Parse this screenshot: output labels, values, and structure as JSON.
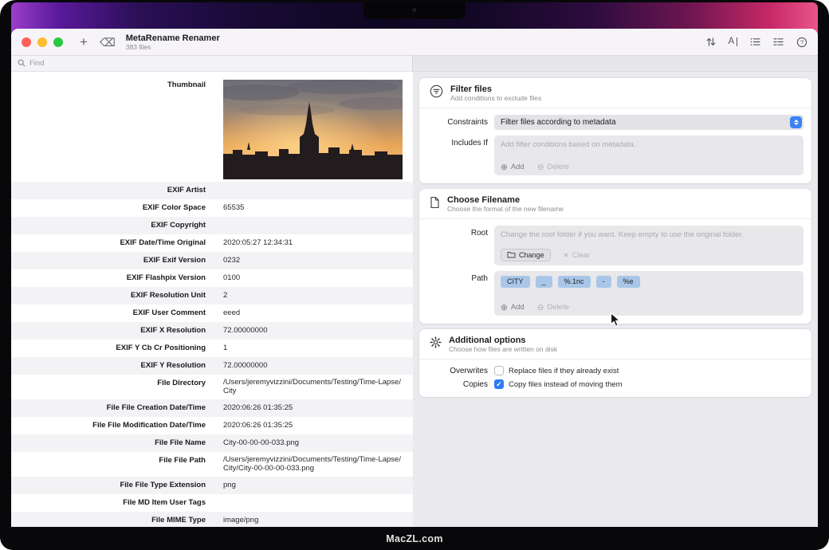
{
  "frame": {
    "brand": "MacZL.com"
  },
  "window": {
    "title": "MetaRename Renamer",
    "subtitle": "383 files",
    "add_glyph": "+",
    "clear_glyph": "⌫",
    "toolbar_icons": [
      "sort-icon",
      "rename-icon",
      "bullet-list-icon",
      "group-list-icon",
      "help-icon"
    ]
  },
  "search": {
    "placeholder": "Find"
  },
  "metadata_table": {
    "rows": [
      {
        "label": "Thumbnail",
        "value": "",
        "type": "image"
      },
      {
        "label": "EXIF Artist",
        "value": ""
      },
      {
        "label": "EXIF Color Space",
        "value": "65535"
      },
      {
        "label": "EXIF Copyright",
        "value": ""
      },
      {
        "label": "EXIF Date/Time Original",
        "value": "2020:05:27 12:34:31"
      },
      {
        "label": "EXIF Exif Version",
        "value": "0232"
      },
      {
        "label": "EXIF Flashpix Version",
        "value": "0100"
      },
      {
        "label": "EXIF Resolution Unit",
        "value": "2"
      },
      {
        "label": "EXIF User Comment",
        "value": "eeed"
      },
      {
        "label": "EXIF X Resolution",
        "value": "72.00000000"
      },
      {
        "label": "EXIF Y Cb Cr Positioning",
        "value": "1"
      },
      {
        "label": "EXIF Y Resolution",
        "value": "72.00000000"
      },
      {
        "label": "File Directory",
        "value": "/Users/jeremyvizzini/Documents/Testing/Time-Lapse/City"
      },
      {
        "label": "File File Creation Date/Time",
        "value": "2020:06:26 01:35:25"
      },
      {
        "label": "File File Modification Date/Time",
        "value": "2020:06:26 01:35:25"
      },
      {
        "label": "File File Name",
        "value": "City-00-00-00-033.png"
      },
      {
        "label": "File File Path",
        "value": "/Users/jeremyvizzini/Documents/Testing/Time-Lapse/City/City-00-00-00-033.png"
      },
      {
        "label": "File File Type Extension",
        "value": "png"
      },
      {
        "label": "File MD Item User Tags",
        "value": ""
      },
      {
        "label": "File MIME Type",
        "value": "image/png"
      }
    ]
  },
  "panels": {
    "filter": {
      "title": "Filter files",
      "subtitle": "Add conditions to exclude files",
      "constraints_label": "Constraints",
      "constraints_value": "Filter files according to metadata",
      "includes_label": "Includes If",
      "includes_placeholder": "Add filter conditions based on metadata.",
      "add_label": "Add",
      "delete_label": "Delete"
    },
    "filename": {
      "title": "Choose Filename",
      "subtitle": "Choose the format of the new filename",
      "root_label": "Root",
      "root_placeholder": "Change the root folder if you want. Keep empty to use the original folder.",
      "change_label": "Change",
      "clear_label": "Clear",
      "path_label": "Path",
      "tokens": [
        "CITY",
        "_",
        "%.1nc",
        "-",
        "%e"
      ],
      "add_label": "Add",
      "delete_label": "Delete"
    },
    "options": {
      "title": "Additional options",
      "subtitle": "Choose how files are written on disk",
      "overwrites_label": "Overwrites",
      "overwrites_text": "Replace files if they already exist",
      "overwrites_checked": false,
      "copies_label": "Copies",
      "copies_text": "Copy files instead of moving them",
      "copies_checked": true
    }
  },
  "colors": {
    "accent_blue": "#3b82f7",
    "token_blue": "#a9c6e9",
    "traffic_red": "#ff5f57",
    "traffic_yellow": "#febc2e",
    "traffic_green": "#28c840"
  }
}
